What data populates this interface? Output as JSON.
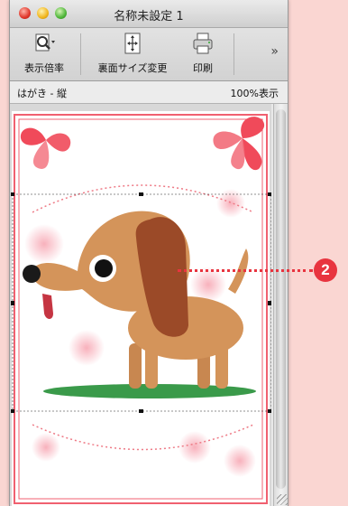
{
  "window": {
    "title": "名称未設定 1"
  },
  "toolbar": {
    "zoom_label": "表示倍率",
    "back_size_label": "裏面サイズ変更",
    "print_label": "印刷",
    "more_glyph": "»"
  },
  "status": {
    "paper": "はがき - 縦",
    "zoom": "100%表示"
  },
  "annotation": {
    "badge": "2"
  },
  "colors": {
    "accent_red": "#e8343f",
    "card_border": "#f06070",
    "dog_body": "#d4945a",
    "dog_ear": "#9b4a28"
  }
}
